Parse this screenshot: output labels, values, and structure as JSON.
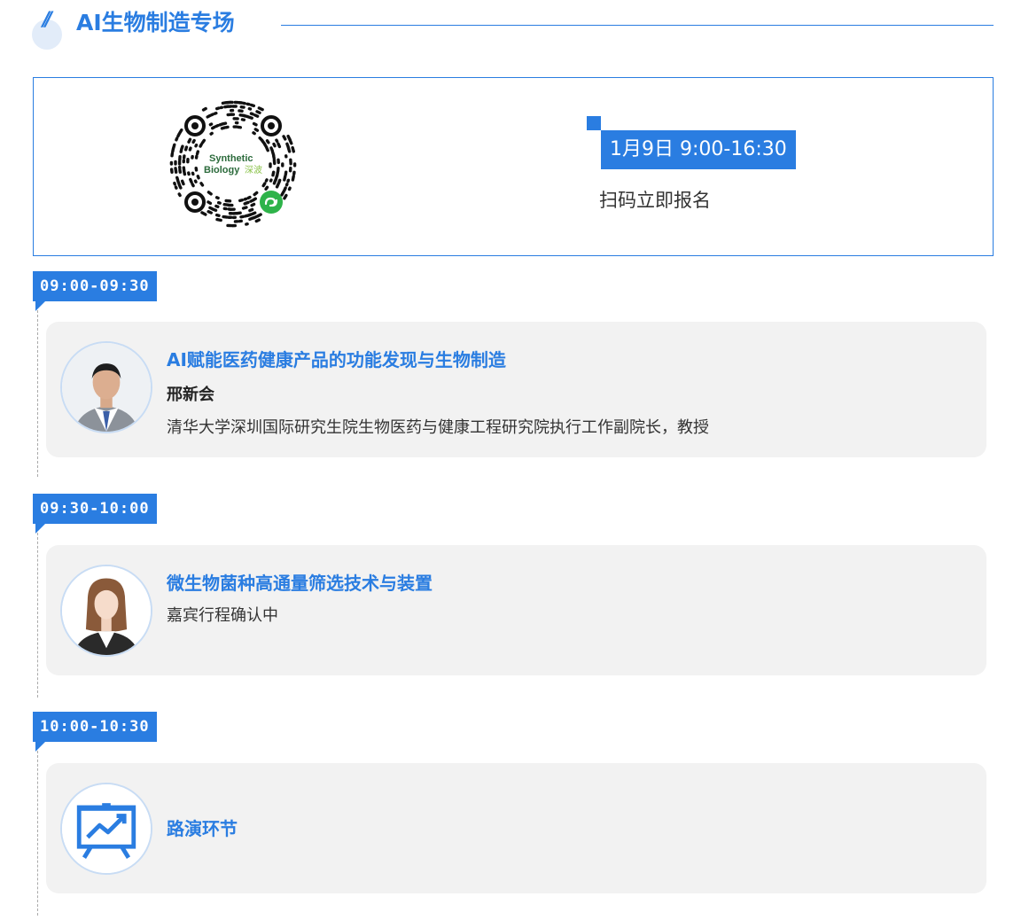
{
  "header": {
    "slash_mark": "//",
    "title": "AI生物制造专场"
  },
  "info": {
    "qr_logo_line1": "Synthetic",
    "qr_logo_line2": "Biology",
    "qr_logo_cn": "深波",
    "date": "1月9日 9:00-16:30",
    "signup_text": "扫码立即报名"
  },
  "colors": {
    "accent": "#2a7de1",
    "card_bg": "#f2f2f2",
    "qr_green": "#2eb34a"
  },
  "sessions": [
    {
      "time": "09:00-09:30",
      "title": "AI赋能医药健康产品的功能发现与生物制造",
      "speaker": "邢新会",
      "affiliation": "清华大学深圳国际研究生院生物医药与健康工程研究院执行工作副院长，教授",
      "avatar_icon": "male-speaker-photo"
    },
    {
      "time": "09:30-10:00",
      "title": "微生物菌种高通量筛选技术与装置",
      "speaker_note": "嘉宾行程确认中",
      "avatar_icon": "female-placeholder-avatar"
    },
    {
      "time": "10:00-10:30",
      "title": "路演环节",
      "avatar_icon": "presentation-board-icon"
    }
  ]
}
